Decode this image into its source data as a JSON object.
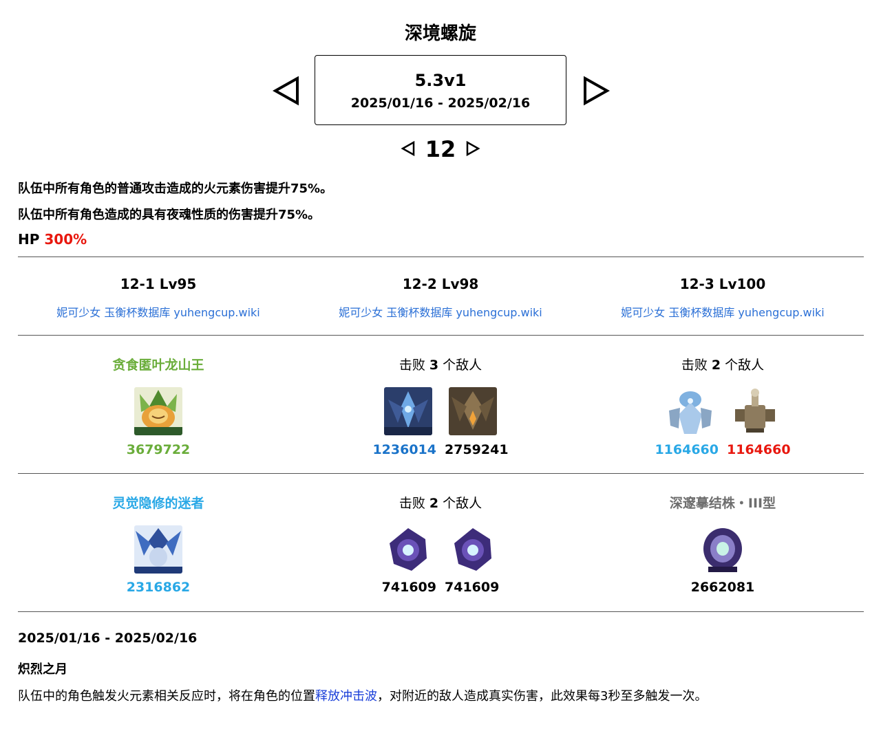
{
  "page_title": "深境螺旋",
  "version": {
    "name": "5.3v1",
    "dates": "2025/01/16 - 2025/02/16"
  },
  "floor": "12",
  "buffs": [
    "队伍中所有角色的普通攻击造成的火元素伤害提升75%。",
    "队伍中所有角色造成的具有夜魂性质的伤害提升75%。"
  ],
  "hp": {
    "label": "HP",
    "value": "300%",
    "color": "#e8180f"
  },
  "chambers": [
    {
      "title": "12-1 Lv95",
      "link": "妮可少女 玉衡杯数据库 yuhengcup.wiki"
    },
    {
      "title": "12-2 Lv98",
      "link": "妮可少女 玉衡杯数据库 yuhengcup.wiki"
    },
    {
      "title": "12-3 Lv100",
      "link": "妮可少女 玉衡杯数据库 yuhengcup.wiki"
    }
  ],
  "first_half": [
    {
      "title": "贪食匿叶龙山王",
      "title_color": "#6aad3a",
      "enemies": [
        {
          "icon": "leaf-dragon-icon",
          "hp": "3679722",
          "hp_color": "#6aad3a"
        }
      ]
    },
    {
      "title_prefix": "击败",
      "count": "3",
      "title_suffix": "个敌人",
      "enemies": [
        {
          "icon": "frost-dragon-icon",
          "hp": "1236014",
          "hp_color": "#1a73c9"
        },
        {
          "icon": "stone-dragon-icon",
          "hp": "2759241",
          "hp_color": "#000000"
        }
      ]
    },
    {
      "title_prefix": "击败",
      "count": "2",
      "title_suffix": "个敌人",
      "enemies": [
        {
          "icon": "ice-construct-icon",
          "hp": "1164660",
          "hp_color": "#29a8e6"
        },
        {
          "icon": "mech-cannon-icon",
          "hp": "1164660",
          "hp_color": "#e8180f"
        }
      ]
    }
  ],
  "second_half": [
    {
      "title": "灵觉隐修的迷者",
      "title_color": "#29a8e6",
      "enemies": [
        {
          "icon": "hydro-hermit-icon",
          "hp": "2316862",
          "hp_color": "#29a8e6"
        }
      ]
    },
    {
      "title_prefix": "击败",
      "count": "2",
      "title_suffix": "个敌人",
      "enemies": [
        {
          "icon": "abyss-orb-icon",
          "hp": "741609",
          "hp_color": "#000000"
        },
        {
          "icon": "abyss-orb-icon",
          "hp": "741609",
          "hp_color": "#000000"
        }
      ]
    },
    {
      "title": "深邃摹结株・III型",
      "title_color": "#6e6e6e",
      "enemies": [
        {
          "icon": "abyss-crystal-icon",
          "hp": "2662081",
          "hp_color": "#000000"
        }
      ]
    }
  ],
  "footer": {
    "date": "2025/01/16 - 2025/02/16",
    "blessing": "炽烈之月",
    "desc_before": "队伍中的角色触发火元素相关反应时，将在角色的位置",
    "desc_link": "释放冲击波",
    "desc_after": "，对附近的敌人造成真实伤害，此效果每3秒至多触发一次。"
  }
}
